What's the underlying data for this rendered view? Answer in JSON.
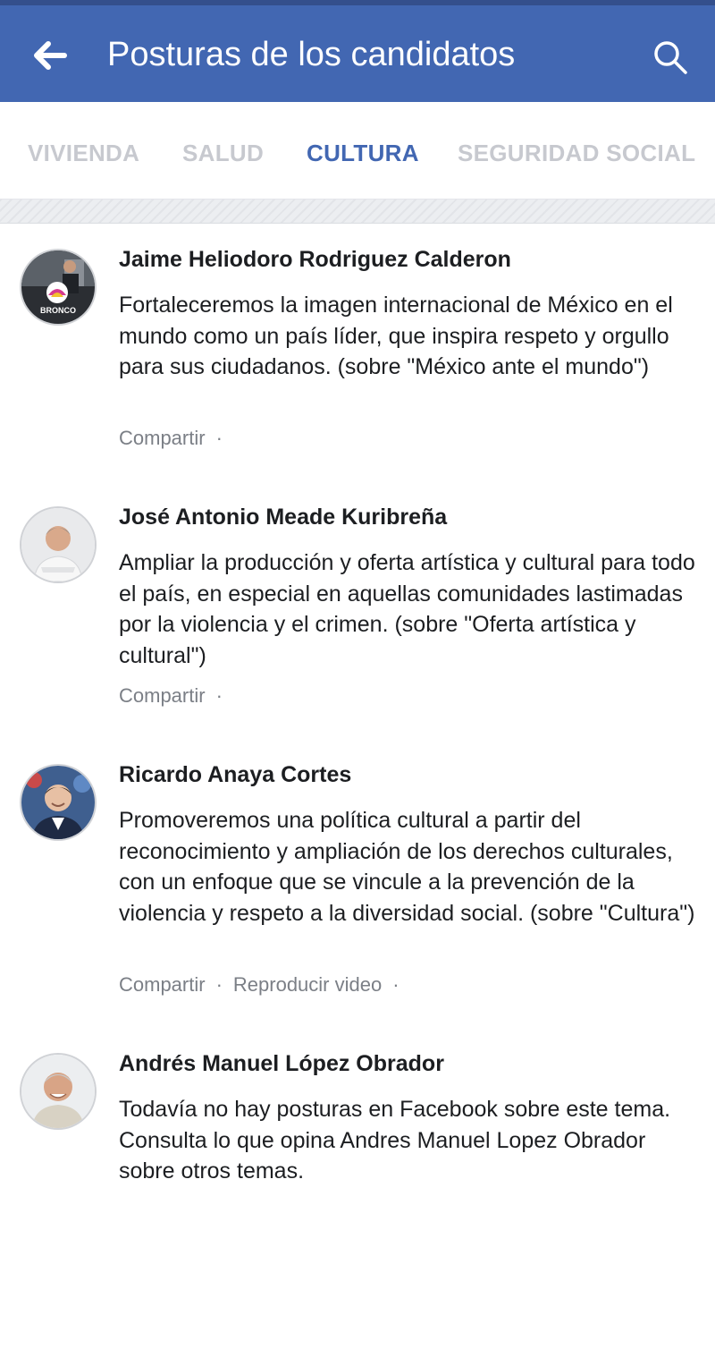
{
  "header": {
    "title": "Posturas de los candidatos",
    "back_icon": "arrow-left-icon",
    "search_icon": "search-icon",
    "color": "#4267b2"
  },
  "tabs": [
    {
      "label": "VIVIENDA",
      "active": false
    },
    {
      "label": "SALUD",
      "active": false
    },
    {
      "label": "CULTURA",
      "active": true
    },
    {
      "label": "SEGURIDAD SOCIAL",
      "active": false
    }
  ],
  "candidates": [
    {
      "name": "Jaime Heliodoro Rodriguez Calderon",
      "avatar_text": "BRONCO",
      "statement": "Fortaleceremos la imagen internacional de México en el mundo como un país líder, que inspira respeto y orgullo para sus ciudadanos. (sobre \"México ante el mundo\")",
      "share": "Compartir",
      "separator": "·"
    },
    {
      "name": "José Antonio Meade Kuribreña",
      "statement": "Ampliar la producción y oferta artística y cultural para todo el país, en especial en aquellas comunidades lastimadas por la violencia y el crimen. (sobre \"Oferta artística y cultural\")",
      "share": "Compartir",
      "separator": "·"
    },
    {
      "name": "Ricardo Anaya Cortes",
      "statement": "Promoveremos una política cultural a partir del reconocimiento y ampliación de los derechos culturales, con un enfoque que se vincule a la prevención de la violencia y respeto a la diversidad social. (sobre \"Cultura\")",
      "share": "Compartir",
      "video": "Reproducir video",
      "separator": "·"
    },
    {
      "name": "Andrés Manuel López Obrador",
      "statement": "Todavía no hay posturas en Facebook sobre este tema. Consulta lo que opina Andres Manuel Lopez Obrador sobre otros temas."
    }
  ]
}
